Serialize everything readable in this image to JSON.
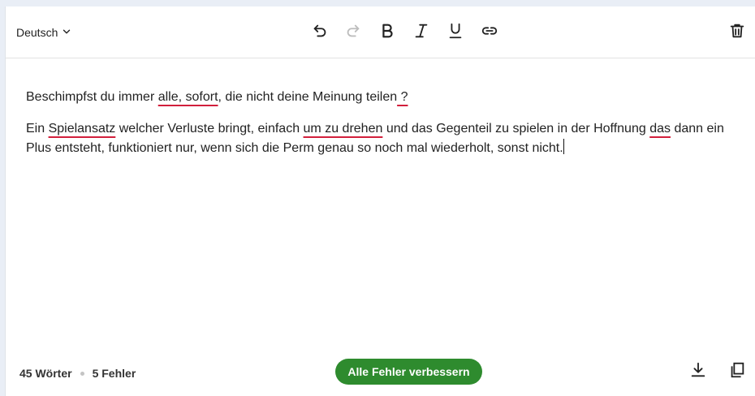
{
  "toolbar": {
    "language": "Deutsch",
    "icons": [
      "chevron-down-icon",
      "undo-icon",
      "redo-icon",
      "bold-icon",
      "italic-icon",
      "underline-icon",
      "link-icon",
      "trash-icon"
    ]
  },
  "text": {
    "p1": {
      "s1": "Beschimpfst du immer ",
      "e1": "alle, sofort",
      "s2": ", die nicht deine Meinung teilen",
      "e2": " ?"
    },
    "p2": {
      "s1": "Ein ",
      "e1": "Spielansatz",
      "s2": " welcher Verluste bringt, einfach ",
      "e2": "um zu drehen",
      "s3": " und das Gegenteil zu spielen in der Hoffnung ",
      "e3": "das",
      "s4": " dann ein Plus entsteht, funktioniert nur, wenn sich die Perm genau so noch mal wiederholt, sonst nicht."
    }
  },
  "footer": {
    "word_count": "45 Wörter",
    "error_count": "5 Fehler",
    "fix_all_label": "Alle Fehler verbessern"
  },
  "colors": {
    "accent_green": "#2e8b2e",
    "error_underline": "#d21f3c"
  }
}
